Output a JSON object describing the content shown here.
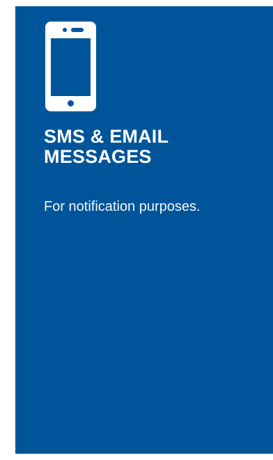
{
  "card": {
    "background_color": "#00559a",
    "icon": "mobile-phone-icon",
    "title": "SMS & EMAIL\nMESSAGES",
    "description": "For notification purposes."
  }
}
